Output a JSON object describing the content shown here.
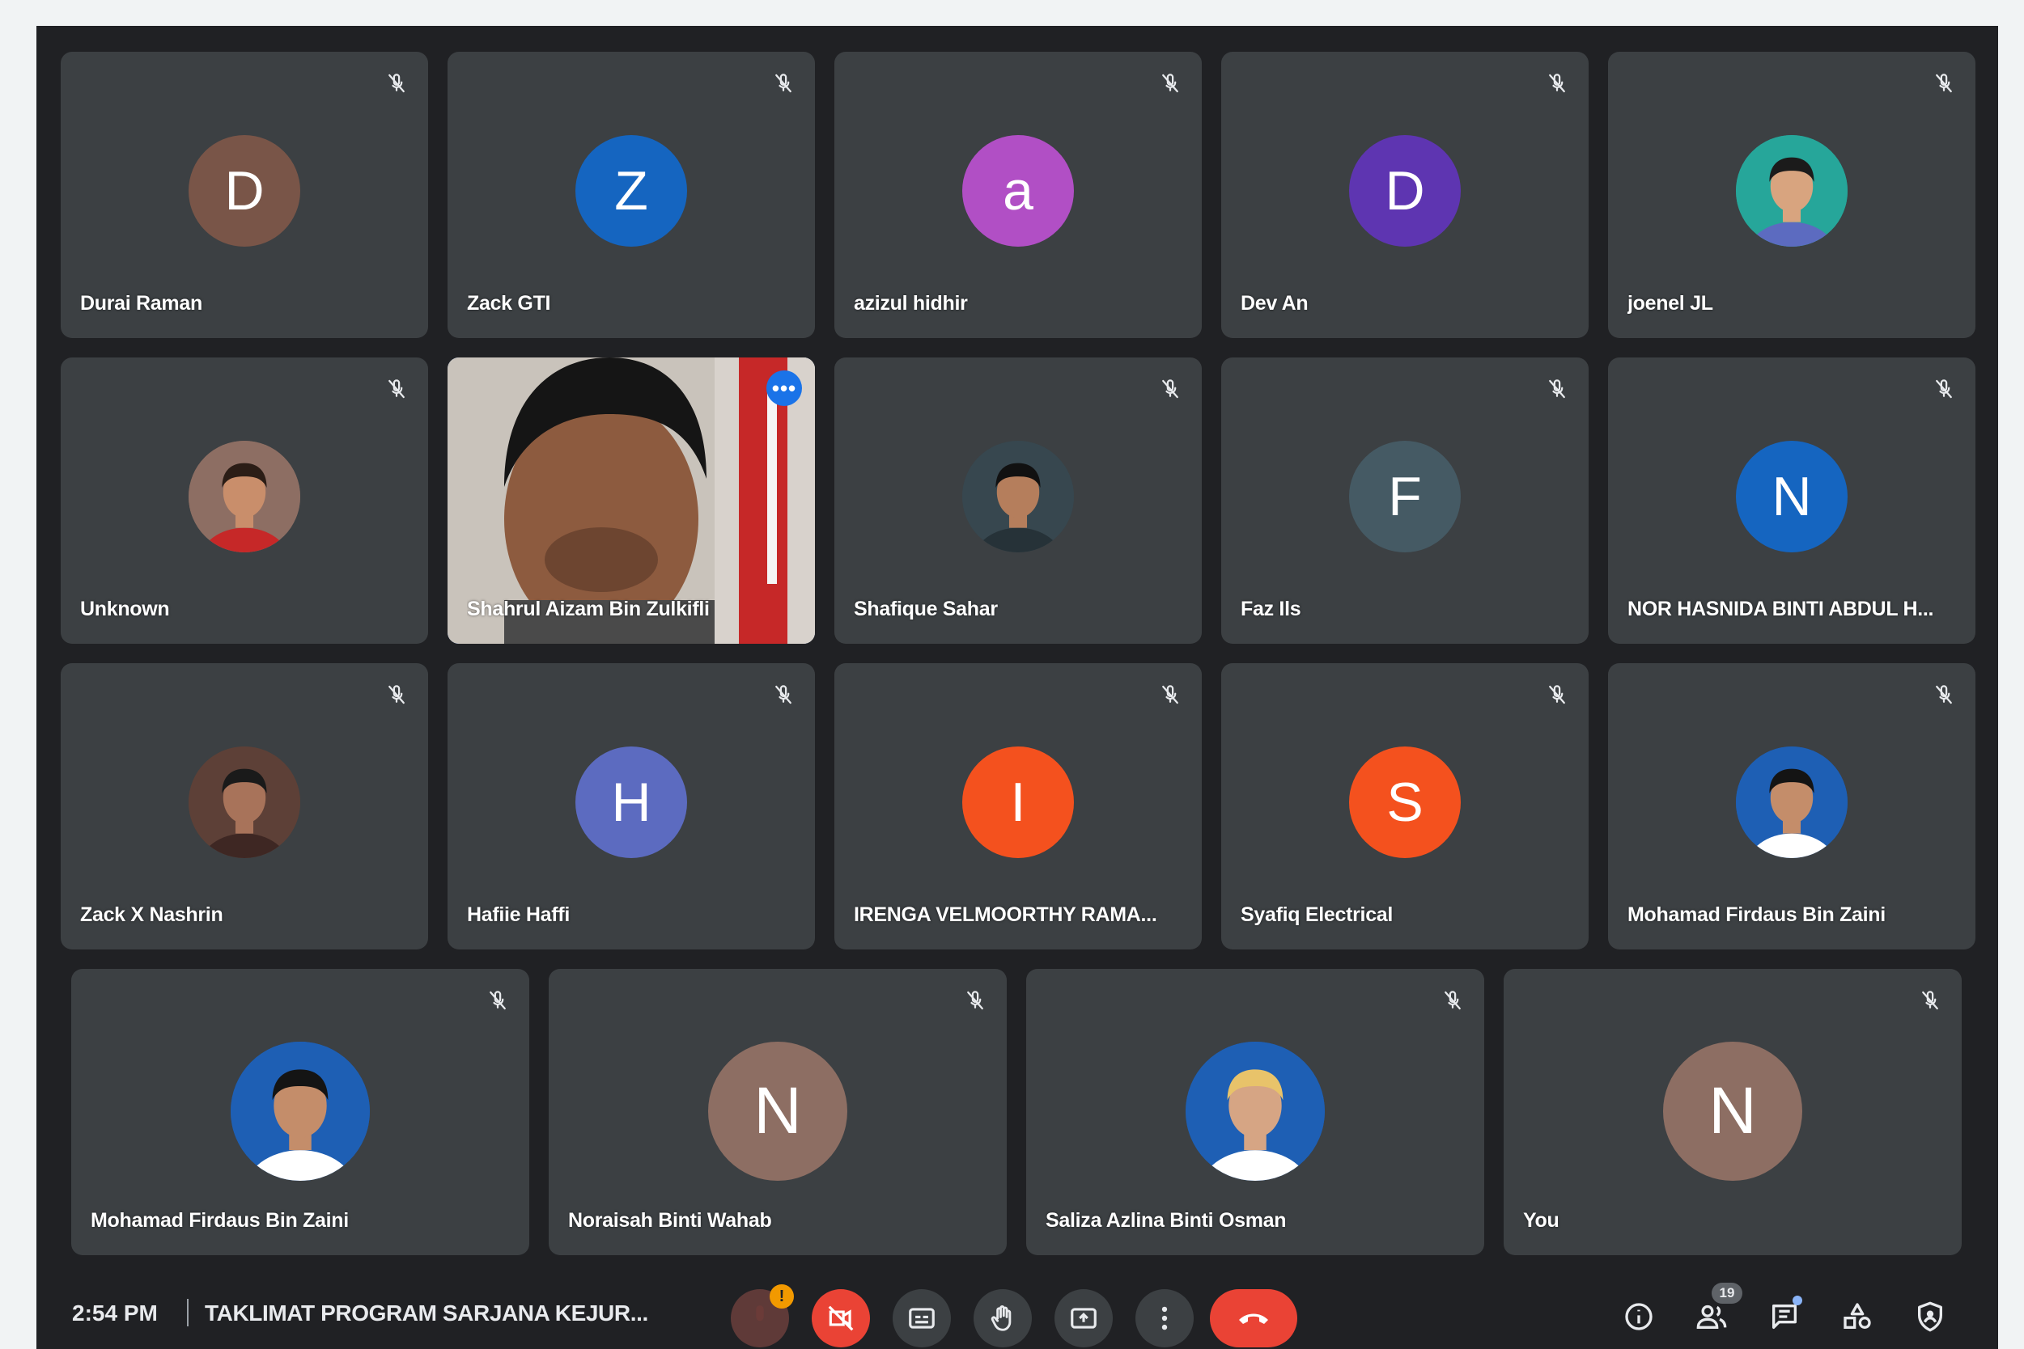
{
  "colors": {
    "background": "#202124",
    "tile": "#3c4043",
    "active_outline": "#8ab4f8",
    "end_call": "#ea4335"
  },
  "participants": [
    {
      "name": "Durai Raman",
      "initial": "D",
      "avatar_color": "#795548",
      "avatar_type": "letter"
    },
    {
      "name": "Zack GTI",
      "initial": "Z",
      "avatar_color": "#1565c0",
      "avatar_type": "letter"
    },
    {
      "name": "azizul hidhir",
      "initial": "a",
      "avatar_color": "#b14fc5",
      "avatar_type": "letter"
    },
    {
      "name": "Dev An",
      "initial": "D",
      "avatar_color": "#5e35b1",
      "avatar_type": "letter"
    },
    {
      "name": "joenel JL",
      "initial": "",
      "avatar_color": "#26a69a",
      "avatar_type": "photo"
    },
    {
      "name": "Unknown",
      "initial": "",
      "avatar_color": "#8d6e63",
      "avatar_type": "photo"
    },
    {
      "name": "Shahrul Aizam Bin Zulkifli",
      "initial": "",
      "avatar_color": "#b0a090",
      "avatar_type": "video"
    },
    {
      "name": "Shafique Sahar",
      "initial": "",
      "avatar_color": "#37474f",
      "avatar_type": "photo"
    },
    {
      "name": "Faz Ils",
      "initial": "F",
      "avatar_color": "#455a64",
      "avatar_type": "letter"
    },
    {
      "name": "NOR HASNIDA BINTI ABDUL H...",
      "initial": "N",
      "avatar_color": "#1565c0",
      "avatar_type": "letter"
    },
    {
      "name": "Zack X Nashrin",
      "initial": "",
      "avatar_color": "#5d4037",
      "avatar_type": "photo"
    },
    {
      "name": "Hafiie Haffi",
      "initial": "H",
      "avatar_color": "#5c6bc0",
      "avatar_type": "letter"
    },
    {
      "name": "IRENGA VELMOORTHY RAMA...",
      "initial": "I",
      "avatar_color": "#f4511e",
      "avatar_type": "letter"
    },
    {
      "name": "Syafiq Electrical",
      "initial": "S",
      "avatar_color": "#f4511e",
      "avatar_type": "letter"
    },
    {
      "name": "Mohamad Firdaus Bin Zaini",
      "initial": "",
      "avatar_color": "#1e5fb4",
      "avatar_type": "photo"
    },
    {
      "name": "Mohamad Firdaus Bin Zaini",
      "initial": "",
      "avatar_color": "#1e5fb4",
      "avatar_type": "photo"
    },
    {
      "name": "Noraisah Binti Wahab",
      "initial": "N",
      "avatar_color": "#8d6e63",
      "avatar_type": "letter"
    },
    {
      "name": "Saliza Azlina Binti Osman",
      "initial": "",
      "avatar_color": "#1e5fb4",
      "avatar_type": "photo"
    },
    {
      "name": "You",
      "initial": "N",
      "avatar_color": "#8d6e63",
      "avatar_type": "letter"
    }
  ],
  "bottom_bar": {
    "time": "2:54 PM",
    "meeting_title": "TAKLIMAT PROGRAM SARJANA KEJUR...",
    "mic_badge": "!",
    "people_count": "19"
  },
  "icons": {
    "tile_status": "mic-off-icon",
    "video_more": "more-options-icon",
    "controls": [
      "mic-off-icon",
      "camera-off-icon",
      "captions-icon",
      "raise-hand-icon",
      "present-screen-icon",
      "more-vert-icon",
      "end-call-icon"
    ],
    "right": [
      "info-icon",
      "people-icon",
      "chat-icon",
      "activities-icon",
      "host-controls-icon"
    ]
  }
}
